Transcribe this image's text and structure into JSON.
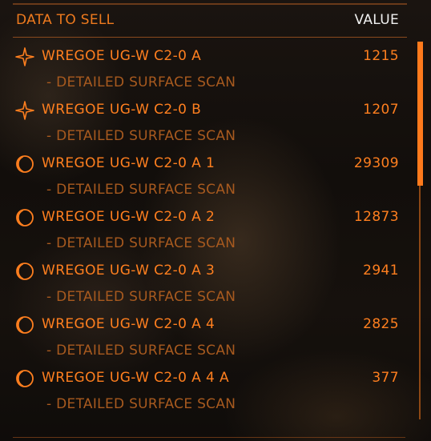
{
  "header": {
    "left": "DATA TO SELL",
    "right": "VALUE"
  },
  "entries": [
    {
      "icon": "star-icon",
      "name": "WREGOE UG-W C2-0 A",
      "value": "1215",
      "detail": "- DETAILED SURFACE SCAN"
    },
    {
      "icon": "star-icon",
      "name": "WREGOE UG-W C2-0 B",
      "value": "1207",
      "detail": "- DETAILED SURFACE SCAN"
    },
    {
      "icon": "planet-icon",
      "name": "WREGOE UG-W C2-0 A 1",
      "value": "29309",
      "detail": "- DETAILED SURFACE SCAN"
    },
    {
      "icon": "planet-icon",
      "name": "WREGOE UG-W C2-0 A 2",
      "value": "12873",
      "detail": "- DETAILED SURFACE SCAN"
    },
    {
      "icon": "planet-icon",
      "name": "WREGOE UG-W C2-0 A 3",
      "value": "2941",
      "detail": "- DETAILED SURFACE SCAN"
    },
    {
      "icon": "planet-icon",
      "name": "WREGOE UG-W C2-0 A 4",
      "value": "2825",
      "detail": "- DETAILED SURFACE SCAN"
    },
    {
      "icon": "planet-icon",
      "name": "WREGOE UG-W C2-0 A 4 A",
      "value": "377",
      "detail": "- DETAILED SURFACE SCAN"
    }
  ],
  "colors": {
    "accent": "#ff7f1f",
    "detail": "#a85a1f",
    "header_value": "#f0f0f0"
  }
}
